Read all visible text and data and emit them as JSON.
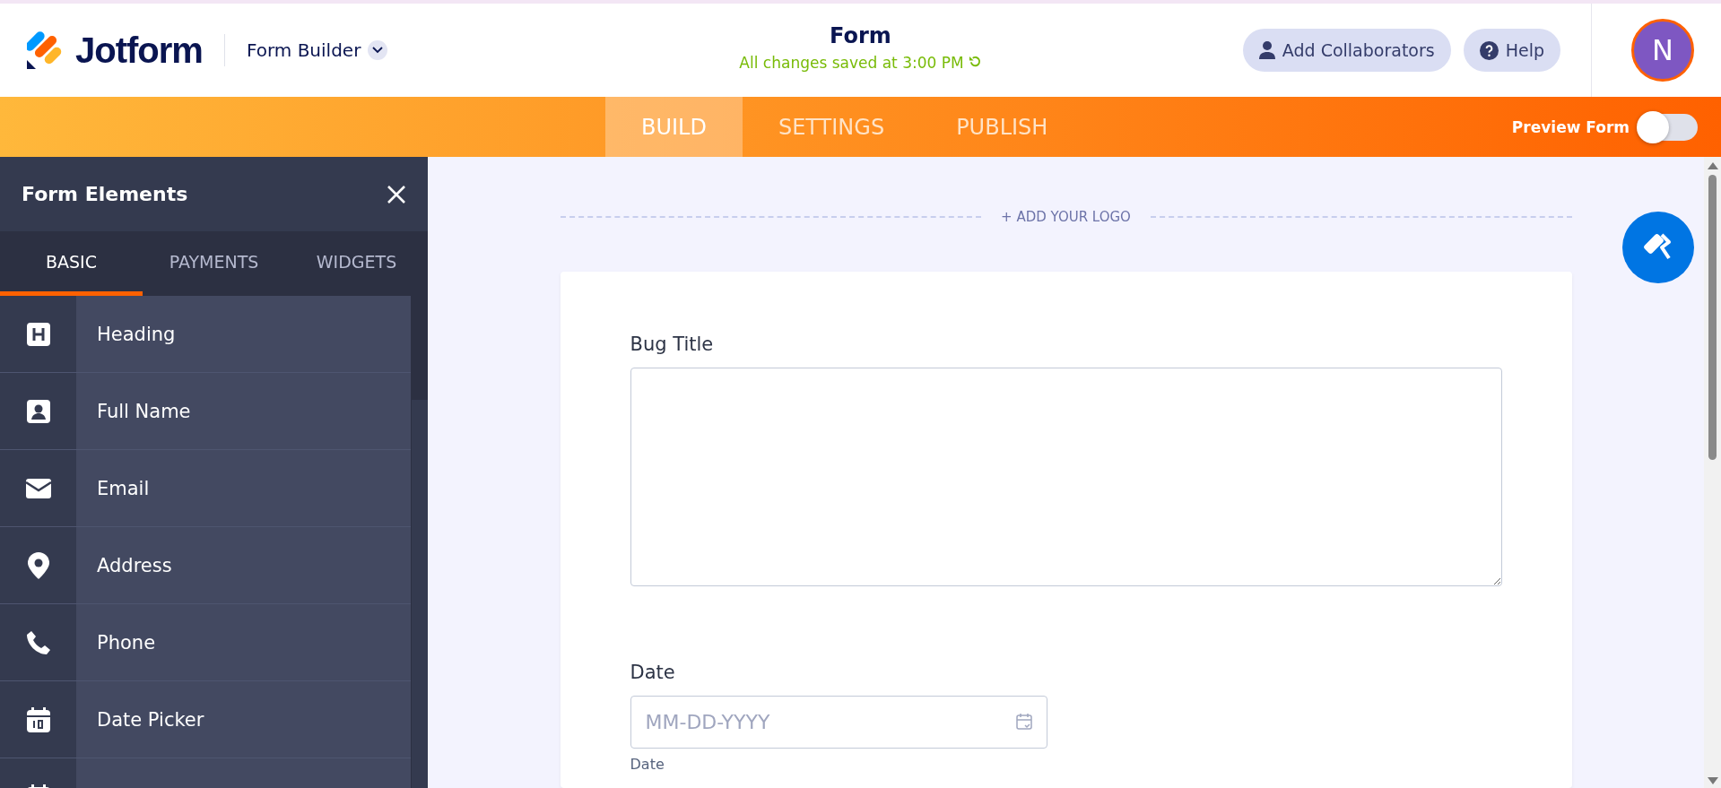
{
  "header": {
    "brand": "Jotform",
    "builder_menu": "Form Builder",
    "form_title": "Form",
    "save_status": "All changes saved at 3:00 PM",
    "buttons": [
      {
        "kind": "person",
        "label": "Add Collaborators"
      },
      {
        "kind": "help",
        "label": "Help"
      }
    ],
    "avatar": "N"
  },
  "nav": {
    "tabs": [
      {
        "label": "BUILD",
        "selected": true
      },
      {
        "label": "SETTINGS",
        "selected": false
      },
      {
        "label": "PUBLISH",
        "selected": false
      }
    ],
    "preview": {
      "label": "Preview Form",
      "on": false
    }
  },
  "sidebar": {
    "title": "Form Elements",
    "tabs": [
      {
        "label": "BASIC",
        "selected": true
      },
      {
        "label": "PAYMENTS",
        "selected": false
      },
      {
        "label": "WIDGETS",
        "selected": false
      }
    ],
    "items": [
      {
        "kind": "heading",
        "label": "Heading"
      },
      {
        "kind": "person",
        "label": "Full Name"
      },
      {
        "kind": "email",
        "label": "Email"
      },
      {
        "kind": "pin",
        "label": "Address"
      },
      {
        "kind": "phone",
        "label": "Phone"
      },
      {
        "kind": "calendar",
        "label": "Date Picker"
      },
      {
        "kind": "calendar"
      }
    ]
  },
  "canvas": {
    "add_logo": "+ ADD YOUR LOGO",
    "fields": [
      {
        "kind": "textarea",
        "label": "Bug Title"
      },
      {
        "kind": "date",
        "label": "Date",
        "placeholder": "MM-DD-YYYY",
        "sublabel": "Date"
      }
    ]
  }
}
